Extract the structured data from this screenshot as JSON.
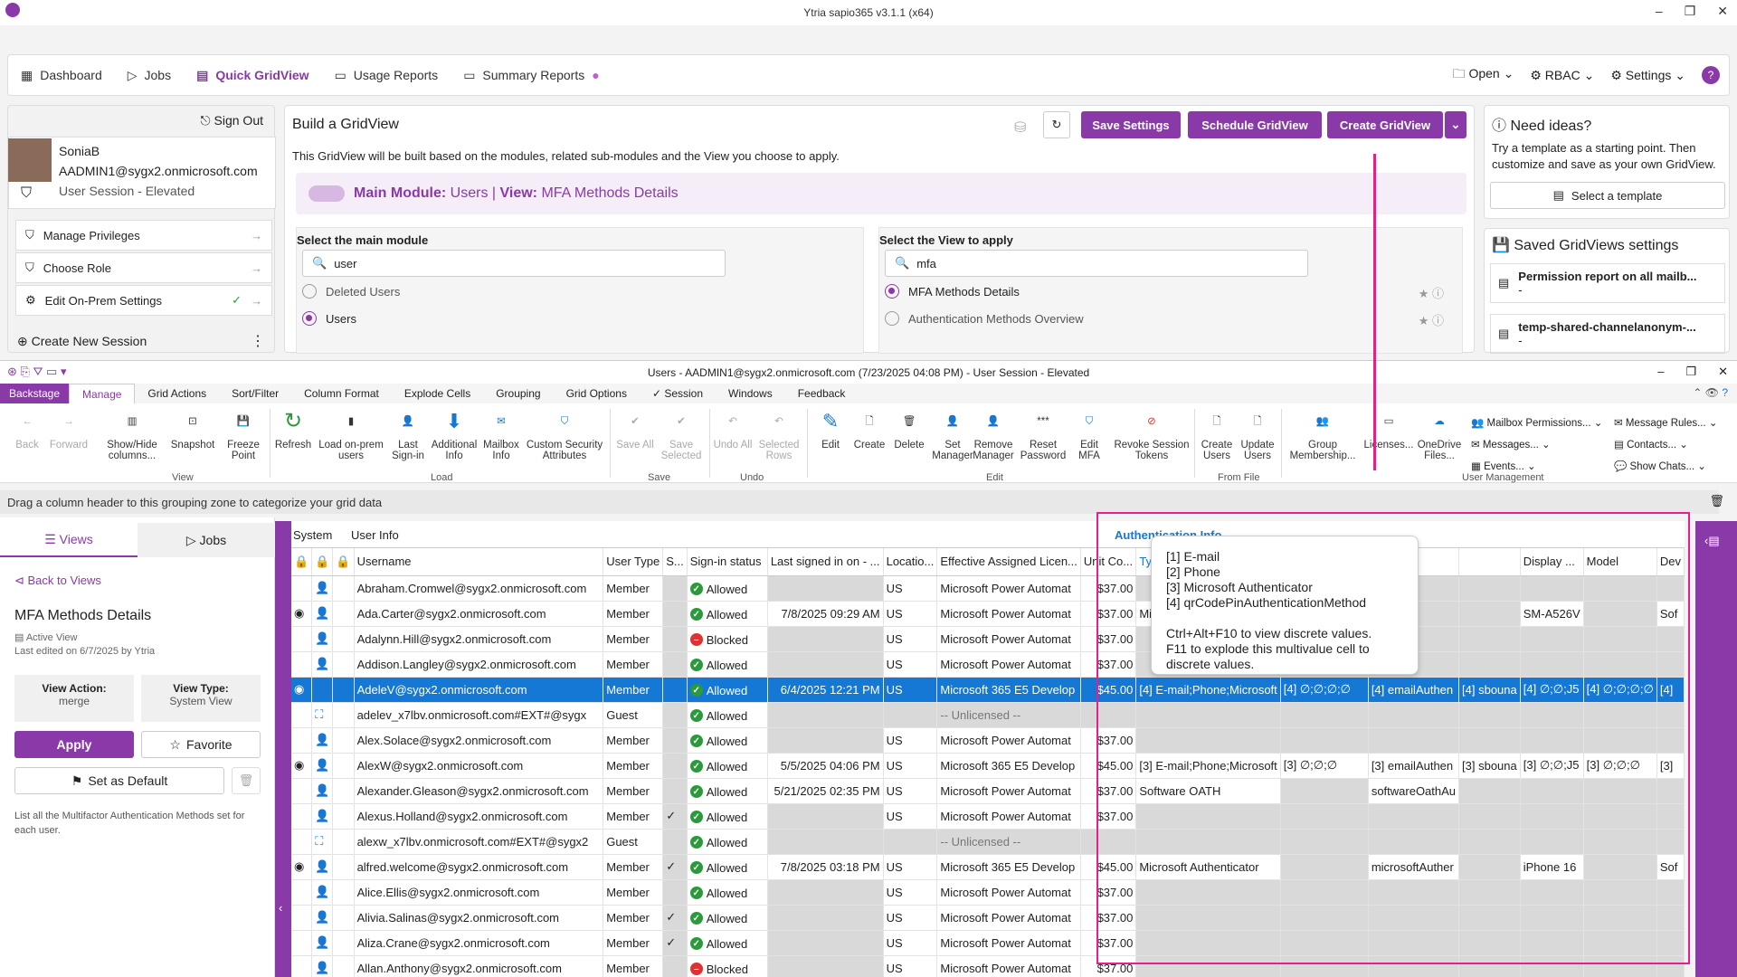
{
  "app": {
    "title": "Ytria sapio365 v3.1.1 (x64)"
  },
  "nav": {
    "tabs": [
      {
        "label": "Dashboard"
      },
      {
        "label": "Jobs"
      },
      {
        "label": "Quick GridView"
      },
      {
        "label": "Usage Reports"
      },
      {
        "label": "Summary Reports"
      }
    ],
    "open": "Open",
    "rbac": "RBAC",
    "settings": "Settings",
    "help": "?"
  },
  "session": {
    "sign_out": "Sign Out",
    "name": "SoniaB",
    "email": "AADMIN1@sygx2.onmicrosoft.com",
    "session_type": "User Session - Elevated",
    "menu": [
      "Manage Privileges",
      "Choose Role",
      "Edit On-Prem Settings"
    ],
    "create_session": "Create New Session"
  },
  "build": {
    "title": "Build a GridView",
    "save_settings": "Save Settings",
    "schedule": "Schedule GridView",
    "create": "Create GridView",
    "description": "This GridView will be built based on the modules, related sub-modules and the View you choose to apply.",
    "main_module_label": "Main Module:",
    "main_module_value": "Users",
    "view_label": "View:",
    "view_value": "MFA Methods Details",
    "select_module": "Select the main module",
    "select_view": "Select the View to apply",
    "module_search": "user",
    "view_search": "mfa",
    "modules": [
      "Deleted Users",
      "Users"
    ],
    "views": [
      "MFA Methods Details",
      "Authentication Methods Overview"
    ]
  },
  "ideas": {
    "title": "Need ideas?",
    "text": "Try a template as a starting point. Then customize and save as your own GridView.",
    "button": "Select a template",
    "saved_title": "Saved GridViews settings",
    "saved": [
      {
        "name": "Permission report on all mailb...",
        "sub": "-"
      },
      {
        "name": "temp-shared-channelanonym-...",
        "sub": "-"
      }
    ]
  },
  "grid_window": {
    "title": "Users - AADMIN1@sygx2.onmicrosoft.com (7/23/2025 04:08 PM) - User Session - Elevated"
  },
  "ribbon_tabs": [
    "Backstage",
    "Manage",
    "Grid Actions",
    "Sort/Filter",
    "Column Format",
    "Explode Cells",
    "Grouping",
    "Grid Options",
    "Session",
    "Windows",
    "Feedback"
  ],
  "ribbon": {
    "buttons": [
      {
        "label": "Back"
      },
      {
        "label": "Forward"
      },
      {
        "label": "Show/Hide columns..."
      },
      {
        "label": "Snapshot"
      },
      {
        "label": "Freeze Point"
      },
      {
        "label": "Refresh"
      },
      {
        "label": "Load on-prem users"
      },
      {
        "label": "Last Sign-in"
      },
      {
        "label": "Additional Info"
      },
      {
        "label": "Mailbox Info"
      },
      {
        "label": "Custom Security Attributes"
      },
      {
        "label": "Save All"
      },
      {
        "label": "Save Selected"
      },
      {
        "label": "Undo All"
      },
      {
        "label": "Selected Rows"
      },
      {
        "label": "Edit"
      },
      {
        "label": "Create"
      },
      {
        "label": "Delete"
      },
      {
        "label": "Set Manager"
      },
      {
        "label": "Remove Manager"
      },
      {
        "label": "Reset Password"
      },
      {
        "label": "Edit MFA"
      },
      {
        "label": "Revoke Session Tokens"
      },
      {
        "label": "Create Users"
      },
      {
        "label": "Update Users"
      },
      {
        "label": "Group Membership..."
      },
      {
        "label": "Licenses..."
      },
      {
        "label": "OneDrive Files..."
      }
    ],
    "small": [
      "Mailbox Permissions...",
      "Messages...",
      "Events...",
      "Message Rules...",
      "Contacts...",
      "Show Chats..."
    ],
    "groups": [
      "View",
      "Load",
      "Save",
      "Undo",
      "Edit",
      "From File",
      "User Management"
    ]
  },
  "grouping_zone": "Drag a column header to this grouping zone to categorize your grid data",
  "left": {
    "tab_views": "Views",
    "tab_jobs": "Jobs",
    "back": "Back to Views",
    "view_name": "MFA Methods Details",
    "active": "Active View",
    "edited": "Last edited on 6/7/2025 by Ytria",
    "view_action_label": "View Action:",
    "view_action": "merge",
    "view_type_label": "View Type:",
    "view_type": "System View",
    "apply": "Apply",
    "favorite": "Favorite",
    "default": "Set as Default",
    "desc": "List all the Multifactor Authentication Methods set for each user."
  },
  "grid": {
    "groups": [
      "System",
      "User Info",
      "Authentication Info"
    ],
    "headers": [
      "Username",
      "User Type",
      "S...",
      "Sign-in status",
      "Last signed in on - ...",
      "Locatio...",
      "Effective Assigned Licen...",
      "Unit Co...",
      "Type (F...",
      "",
      "",
      "",
      "Display ...",
      "Model",
      "Dev"
    ],
    "rows": [
      [
        "Abraham.Cromwel@sygx2.onmicrosoft.com",
        "Member",
        "",
        "Allowed",
        "",
        "US",
        "Microsoft Power Automat",
        "$37.00",
        "",
        "",
        "",
        "",
        "",
        "",
        ""
      ],
      [
        "Ada.Carter@sygx2.onmicrosoft.com",
        "Member",
        "",
        "Allowed",
        "7/8/2025 09:29 AM",
        "US",
        "Microsoft Power Automat",
        "$37.00",
        "Micros",
        "",
        "",
        "",
        "SM-A526V",
        "",
        "Sof"
      ],
      [
        "Adalynn.Hill@sygx2.onmicrosoft.com",
        "Member",
        "",
        "Blocked",
        "",
        "US",
        "Microsoft Power Automat",
        "$37.00",
        "",
        "",
        "",
        "",
        "",
        "",
        ""
      ],
      [
        "Addison.Langley@sygx2.onmicrosoft.com",
        "Member",
        "",
        "Allowed",
        "",
        "US",
        "Microsoft Power Automat",
        "$37.00",
        "",
        "",
        "",
        "",
        "",
        "",
        ""
      ],
      [
        "AdeleV@sygx2.onmicrosoft.com",
        "Member",
        "",
        "Allowed",
        "6/4/2025 12:21 PM",
        "US",
        "Microsoft 365 E5 Develop",
        "$45.00",
        "[4] E-mail;Phone;Microsoft",
        "[4] ∅;∅;∅;∅",
        "[4] emailAuthen",
        "[4] sbouna",
        "[4] ∅;∅;J5",
        "[4] ∅;∅;∅;∅",
        "[4]"
      ],
      [
        "adelev_x7lbv.onmicrosoft.com#EXT#@sygx",
        "Guest",
        "",
        "Allowed",
        "",
        "",
        "-- Unlicensed --",
        "",
        "",
        "",
        "",
        "",
        "",
        "",
        ""
      ],
      [
        "Alex.Solace@sygx2.onmicrosoft.com",
        "Member",
        "",
        "Allowed",
        "",
        "US",
        "Microsoft Power Automat",
        "$37.00",
        "",
        "",
        "",
        "",
        "",
        "",
        ""
      ],
      [
        "AlexW@sygx2.onmicrosoft.com",
        "Member",
        "",
        "Allowed",
        "5/5/2025 04:06 PM",
        "US",
        "Microsoft 365 E5 Develop",
        "$45.00",
        "[3] E-mail;Phone;Microsoft",
        "[3] ∅;∅;∅",
        "[3] emailAuthen",
        "[3] sbouna",
        "[3] ∅;∅;J5",
        "[3] ∅;∅;∅",
        "[3]"
      ],
      [
        "Alexander.Gleason@sygx2.onmicrosoft.com",
        "Member",
        "",
        "Allowed",
        "5/21/2025 02:35 PM",
        "US",
        "Microsoft Power Automat",
        "$37.00",
        "Software OATH",
        "",
        "softwareOathAu",
        "",
        "",
        "",
        ""
      ],
      [
        "Alexus.Holland@sygx2.onmicrosoft.com",
        "Member",
        "✓",
        "Allowed",
        "",
        "US",
        "Microsoft Power Automat",
        "$37.00",
        "",
        "",
        "",
        "",
        "",
        "",
        ""
      ],
      [
        "alexw_x7lbv.onmicrosoft.com#EXT#@sygx2",
        "Guest",
        "",
        "Allowed",
        "",
        "",
        "-- Unlicensed --",
        "",
        "",
        "",
        "",
        "",
        "",
        "",
        ""
      ],
      [
        "alfred.welcome@sygx2.onmicrosoft.com",
        "Member",
        "✓",
        "Allowed",
        "7/8/2025 03:18 PM",
        "US",
        "Microsoft 365 E5 Develop",
        "$45.00",
        "Microsoft Authenticator",
        "",
        "microsoftAuther",
        "",
        "iPhone 16",
        "",
        "Sof"
      ],
      [
        "Alice.Ellis@sygx2.onmicrosoft.com",
        "Member",
        "",
        "Allowed",
        "",
        "US",
        "Microsoft Power Automat",
        "$37.00",
        "",
        "",
        "",
        "",
        "",
        "",
        ""
      ],
      [
        "Alivia.Salinas@sygx2.onmicrosoft.com",
        "Member",
        "✓",
        "Allowed",
        "",
        "US",
        "Microsoft Power Automat",
        "$37.00",
        "",
        "",
        "",
        "",
        "",
        "",
        ""
      ],
      [
        "Aliza.Crane@sygx2.onmicrosoft.com",
        "Member",
        "✓",
        "Allowed",
        "",
        "US",
        "Microsoft Power Automat",
        "$37.00",
        "",
        "",
        "",
        "",
        "",
        "",
        ""
      ],
      [
        "Allan.Anthony@sygx2.onmicrosoft.com",
        "Member",
        "",
        "Blocked",
        "",
        "US",
        "Microsoft Power Automat",
        "$37.00",
        "",
        "",
        "",
        "",
        "",
        "",
        ""
      ]
    ]
  },
  "tooltip": {
    "lines": [
      "[1] E-mail",
      "[2] Phone",
      "[3] Microsoft Authenticator",
      "[4] qrCodePinAuthenticationMethod"
    ],
    "hint1": "Ctrl+Alt+F10 to view discrete values.",
    "hint2": "F11 to explode this multivalue cell to discrete values."
  },
  "colors": {
    "accent": "#8a3aa8",
    "highlight": "#e91e8c",
    "selection": "#1478d4"
  }
}
